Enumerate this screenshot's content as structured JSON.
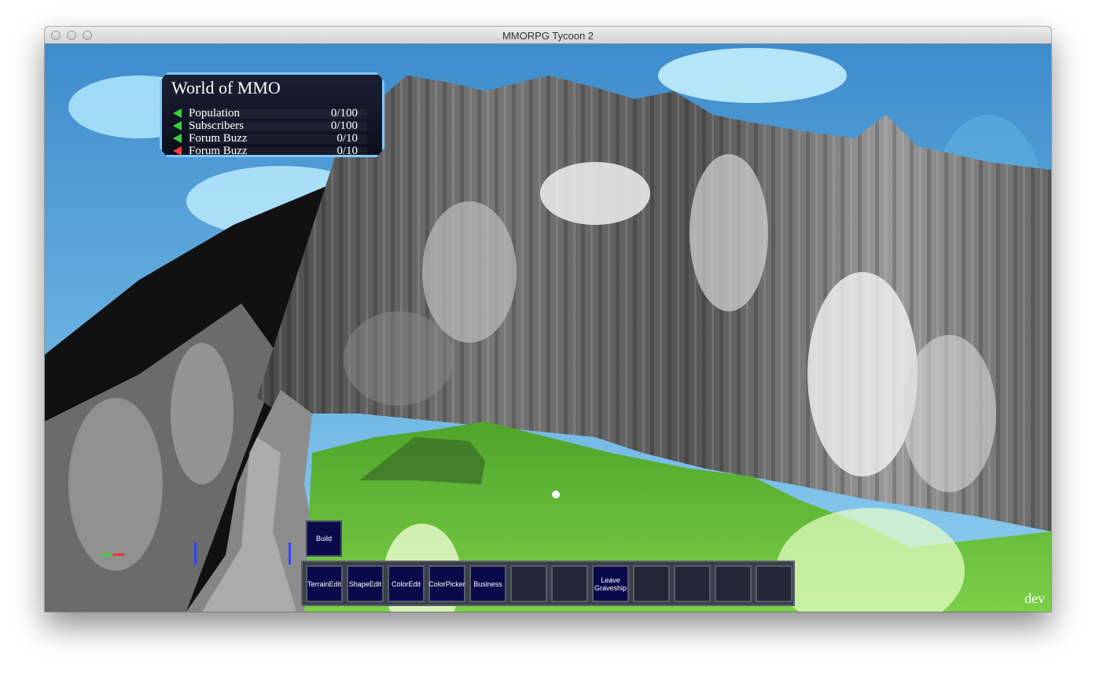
{
  "window": {
    "title": "MMORPG Tycoon 2"
  },
  "stats_panel": {
    "title": "World of MMO",
    "rows": [
      {
        "label": "Population",
        "value": "0/100",
        "trend": "up",
        "color": "#3ad13a"
      },
      {
        "label": "Subscribers",
        "value": "0/100",
        "trend": "up",
        "color": "#3ad13a"
      },
      {
        "label": "Forum Buzz",
        "value": "0/10",
        "trend": "up",
        "color": "#3ad13a"
      },
      {
        "label": "Forum Buzz",
        "value": "0/10",
        "trend": "down",
        "color": "#ff3b3b"
      }
    ]
  },
  "build_button": {
    "label": "Build"
  },
  "toolbar": {
    "slots": [
      {
        "label": "TerrainEdit"
      },
      {
        "label": "ShapeEdit"
      },
      {
        "label": "ColorEdit"
      },
      {
        "label": "ColorPicker"
      },
      {
        "label": "Business"
      },
      {
        "label": ""
      },
      {
        "label": ""
      },
      {
        "label": "Leave Graveship"
      },
      {
        "label": ""
      },
      {
        "label": ""
      },
      {
        "label": ""
      },
      {
        "label": ""
      }
    ]
  },
  "mode_label": "dev",
  "colors": {
    "sky": "#4a9ad4",
    "grass": "#6cbf3e",
    "panel_border": "#7ec8ff",
    "button_fill": "#0a0a4a"
  }
}
